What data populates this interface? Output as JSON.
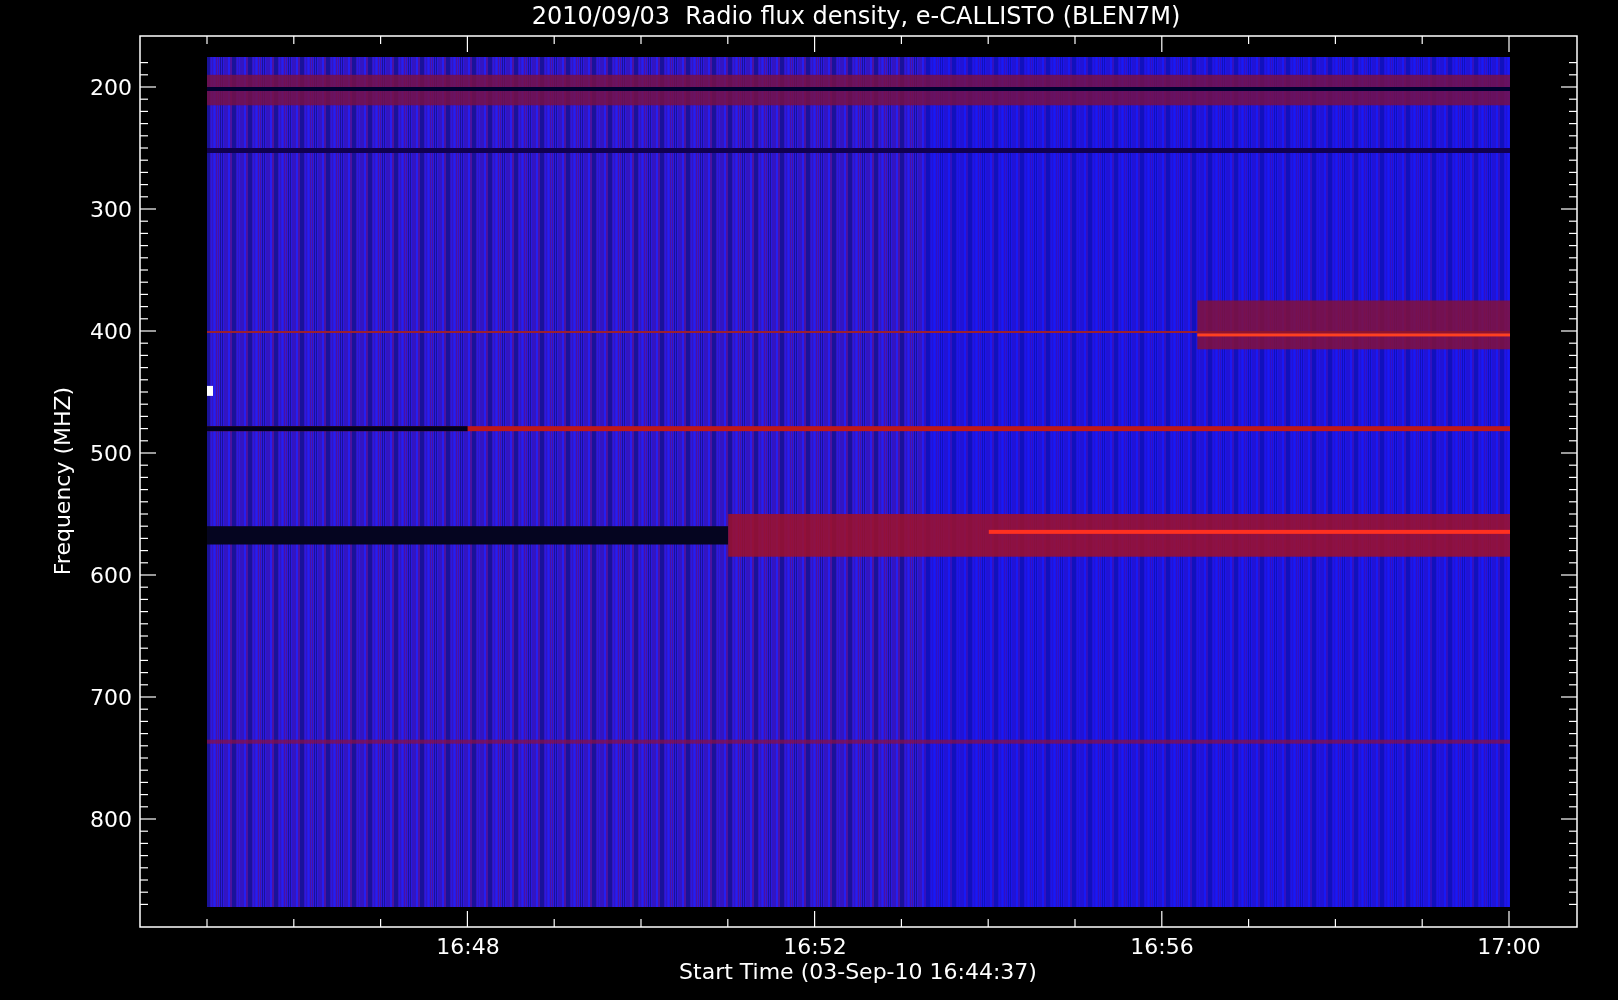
{
  "title": "2010/09/03  Radio flux density, e-CALLISTO (BLEN7M)",
  "y_axis": {
    "label": "Frequency (MHZ)",
    "ticks": [
      "200",
      "300",
      "400",
      "500",
      "600",
      "700",
      "800"
    ]
  },
  "x_axis": {
    "label": "Start Time (03-Sep-10 16:44:37)",
    "ticks": [
      "16:48",
      "16:52",
      "16:56",
      "17:00"
    ]
  }
}
